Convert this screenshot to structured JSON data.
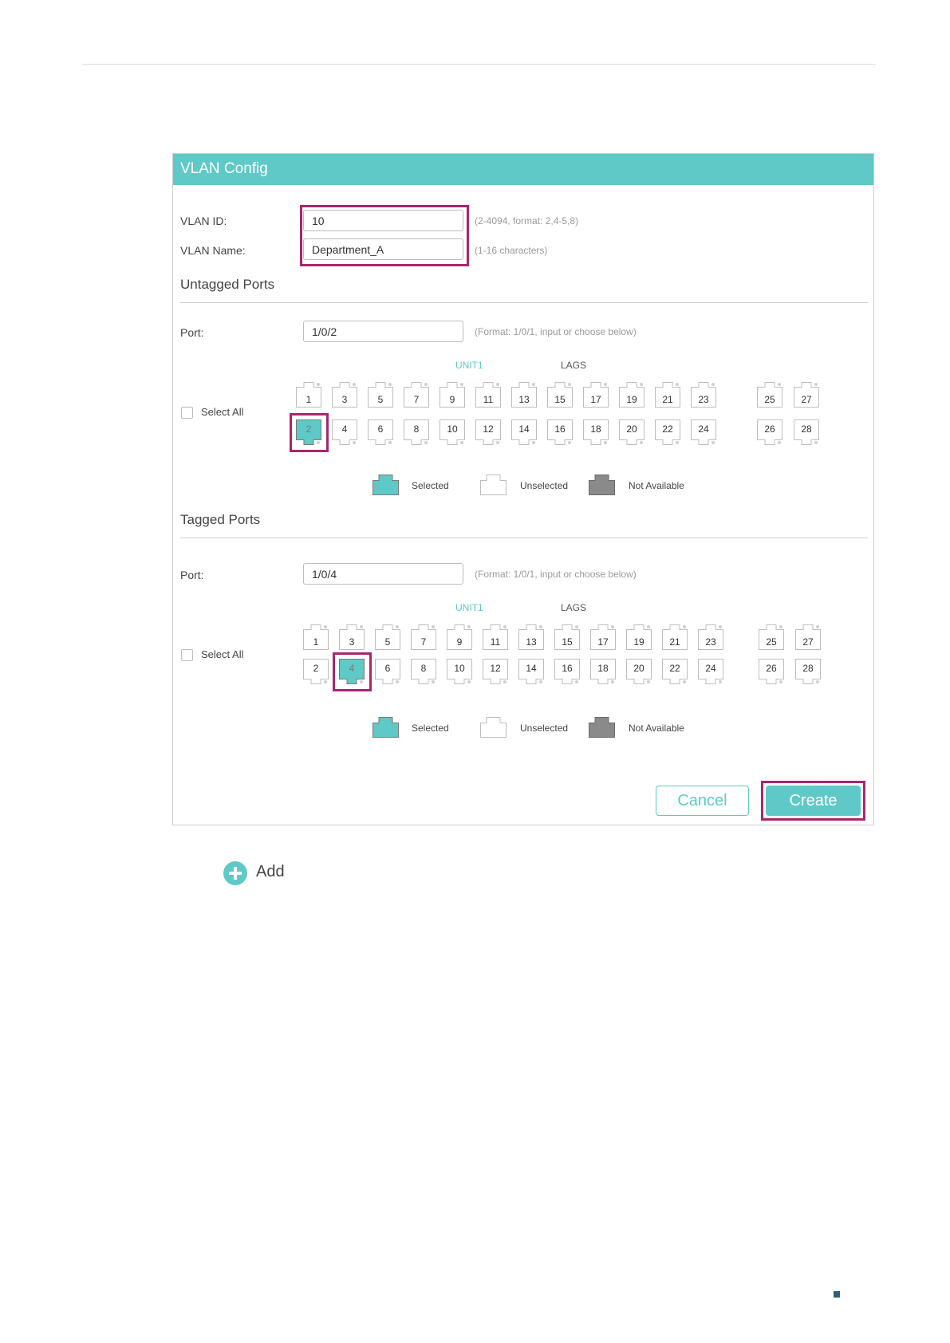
{
  "panel": {
    "title": "VLAN Config"
  },
  "vlan_id": {
    "label": "VLAN ID:",
    "value": "10",
    "hint": "(2-4094, format: 2,4-5,8)"
  },
  "vlan_name": {
    "label": "VLAN Name:",
    "value": "Department_A",
    "hint": "(1-16 characters)"
  },
  "untagged": {
    "title": "Untagged Ports",
    "port_label": "Port:",
    "port_value": "1/0/2",
    "port_hint": "(Format: 1/0/1, input or choose below)",
    "unit_label": "UNIT1",
    "lags_label": "LAGS",
    "select_all": "Select All",
    "selected_ports": [
      "2"
    ]
  },
  "tagged": {
    "title": "Tagged Ports",
    "port_label": "Port:",
    "port_value": "1/0/4",
    "port_hint": "(Format: 1/0/1, input or choose below)",
    "unit_label": "UNIT1",
    "lags_label": "LAGS",
    "select_all": "Select All",
    "selected_ports": [
      "4"
    ]
  },
  "ports": {
    "odd": [
      "1",
      "3",
      "5",
      "7",
      "9",
      "11",
      "13",
      "15",
      "17",
      "19",
      "21",
      "23"
    ],
    "even": [
      "2",
      "4",
      "6",
      "8",
      "10",
      "12",
      "14",
      "16",
      "18",
      "20",
      "22",
      "24"
    ],
    "lag_odd": [
      "25",
      "27"
    ],
    "lag_even": [
      "26",
      "28"
    ]
  },
  "legend": {
    "selected": "Selected",
    "unselected": "Unselected",
    "not_available": "Not Available"
  },
  "buttons": {
    "cancel": "Cancel",
    "create": "Create"
  },
  "add": {
    "label": "Add"
  },
  "colors": {
    "accent": "#5ec9c6",
    "highlight": "#a8266e",
    "not_available": "#8a8a8a"
  }
}
